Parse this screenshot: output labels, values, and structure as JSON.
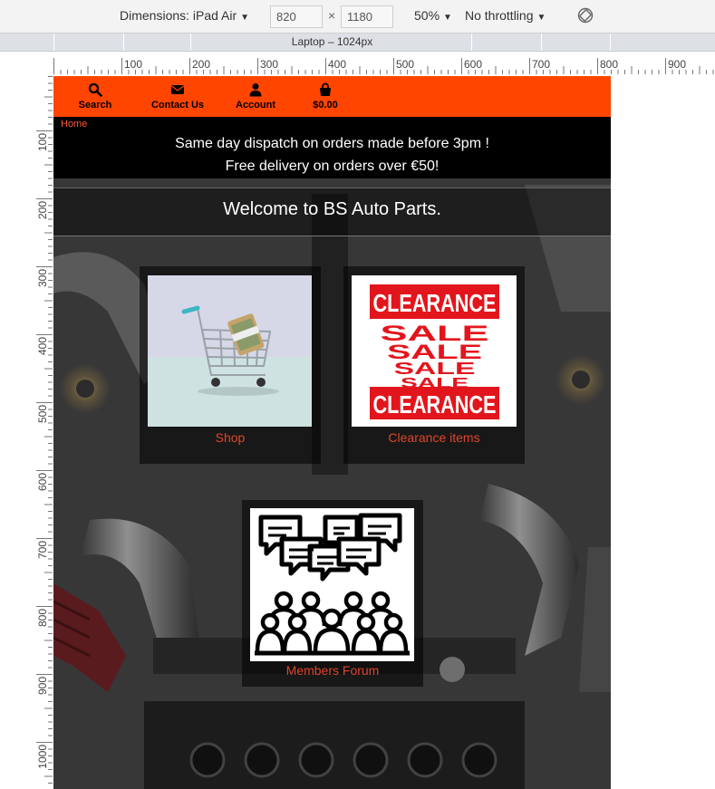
{
  "devtools": {
    "dimensions_label": "Dimensions: iPad Air",
    "width": "820",
    "times": "×",
    "height": "1180",
    "zoom": "50%",
    "throttling": "No throttling",
    "media_query_label": "Laptop – 1024px",
    "h_ruler_ticks": [
      "100",
      "200",
      "300",
      "400",
      "500",
      "600",
      "700",
      "800",
      "900"
    ],
    "v_ruler_ticks": [
      "100",
      "200",
      "300",
      "400",
      "500",
      "600",
      "700",
      "800",
      "900",
      "1000"
    ]
  },
  "site": {
    "accent": "#ff4500",
    "nav": [
      {
        "label": "Search",
        "icon": "search-icon"
      },
      {
        "label": "Contact Us",
        "icon": "envelope-icon"
      },
      {
        "label": "Account",
        "icon": "user-icon"
      },
      {
        "label": "$0.00",
        "icon": "shopping-bag-icon"
      }
    ],
    "breadcrumb": "Home",
    "banner_line1": "Same day dispatch on orders made before 3pm !",
    "banner_line2": "Free delivery on orders over €50!",
    "welcome": "Welcome to BS Auto Parts.",
    "cards": {
      "shop": "Shop",
      "clearance": "Clearance items",
      "forum": "Members Forum"
    },
    "clearance_sign": {
      "top": "CLEARANCE",
      "sale": [
        "SALE",
        "SALE",
        "SALE",
        "SALE"
      ],
      "bottom": "CLEARANCE"
    }
  }
}
